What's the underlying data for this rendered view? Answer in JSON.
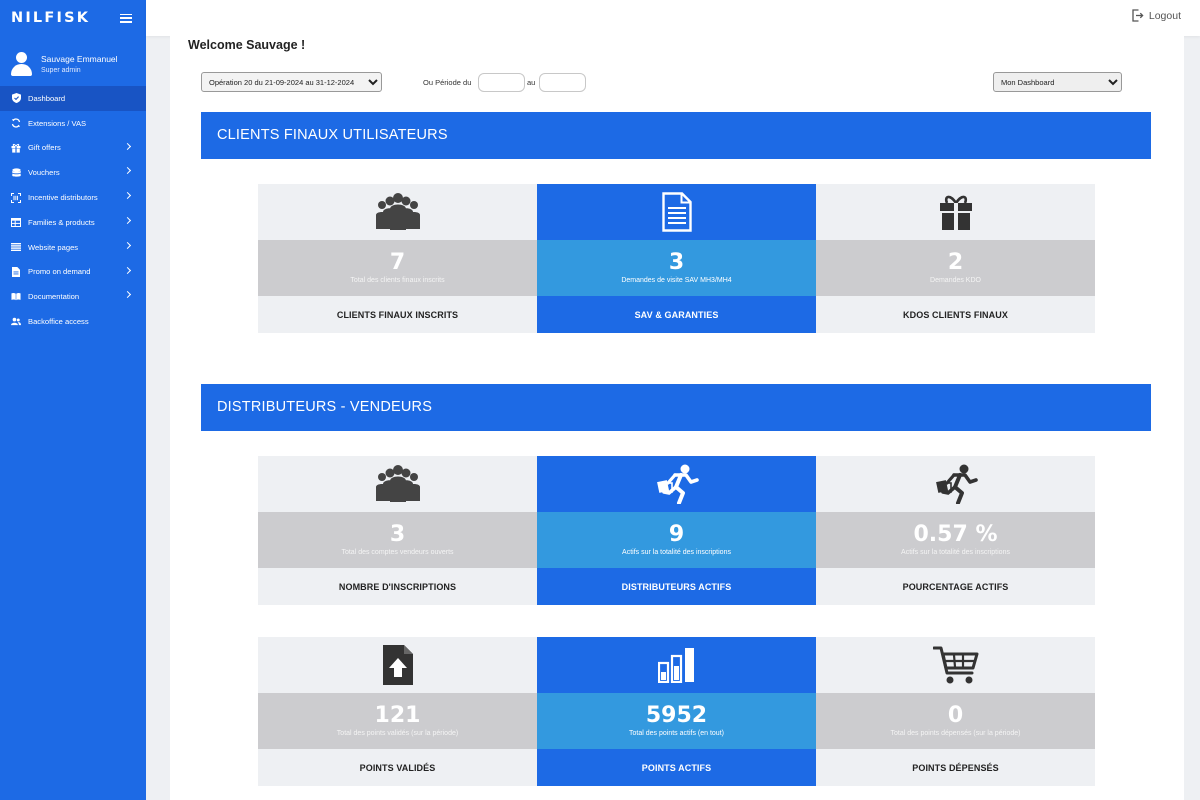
{
  "brand": {
    "logo": "NILFISK"
  },
  "user": {
    "name": "Sauvage Emmanuel",
    "role": "Super admin"
  },
  "sidebar": {
    "items": [
      {
        "label": "Dashboard"
      },
      {
        "label": "Extensions / VAS"
      },
      {
        "label": "Gift offers"
      },
      {
        "label": "Vouchers"
      },
      {
        "label": "Incentive distributors"
      },
      {
        "label": "Families & products"
      },
      {
        "label": "Website pages"
      },
      {
        "label": "Promo on demand"
      },
      {
        "label": "Documentation"
      },
      {
        "label": "Backoffice access"
      }
    ]
  },
  "topbar": {
    "logout": "Logout"
  },
  "welcome": "Welcome Sauvage !",
  "filters": {
    "operation": "Opération 20 du 21-09-2024 au 31-12-2024",
    "period_label": "Ou Période du",
    "au_label": "au",
    "dashboard": "Mon Dashboard"
  },
  "sections": [
    {
      "title": "CLIENTS FINAUX UTILISATEURS"
    },
    {
      "title": "DISTRIBUTEURS - VENDEURS"
    }
  ],
  "cards": {
    "clients": [
      {
        "icon": "group-icon",
        "value": "7",
        "sub": "Total des clients finaux inscrits",
        "label": "CLIENTS FINAUX INSCRITS"
      },
      {
        "icon": "document-icon",
        "value": "3",
        "sub": "Demandes de visite SAV MH3/MH4",
        "label": "SAV & GARANTIES"
      },
      {
        "icon": "gift-icon",
        "value": "2",
        "sub": "Demandes KDO",
        "label": "KDOS CLIENTS FINAUX"
      }
    ],
    "distrib1": [
      {
        "icon": "group-icon",
        "value": "3",
        "sub": "Total des comptes vendeurs ouverts",
        "label": "NOMBRE D'INSCRIPTIONS"
      },
      {
        "icon": "running-shopper-icon",
        "value": "9",
        "sub": "Actifs sur la totalité des inscriptions",
        "label": "DISTRIBUTEURS ACTIFS"
      },
      {
        "icon": "running-shopper-icon",
        "value": "0.57 %",
        "sub": "Actifs sur la totalité des inscriptions",
        "label": "POURCENTAGE ACTIFS"
      }
    ],
    "distrib2": [
      {
        "icon": "upload-file-icon",
        "value": "121",
        "sub": "Total des points validés (sur la période)",
        "label": "POINTS VALIDÉS"
      },
      {
        "icon": "bar-chart-icon",
        "value": "5952",
        "sub": "Total des points actifs (en tout)",
        "label": "POINTS ACTIFS"
      },
      {
        "icon": "cart-icon",
        "value": "0",
        "sub": "Total des points dépensés (sur la période)",
        "label": "POINTS DÉPENSÉS"
      }
    ]
  },
  "colors": {
    "primary": "#1d6ae5",
    "active_nav": "#1854c4",
    "mid_blue": "#3399df",
    "grey_light": "#eef0f3",
    "grey_mid": "#cccccf"
  }
}
